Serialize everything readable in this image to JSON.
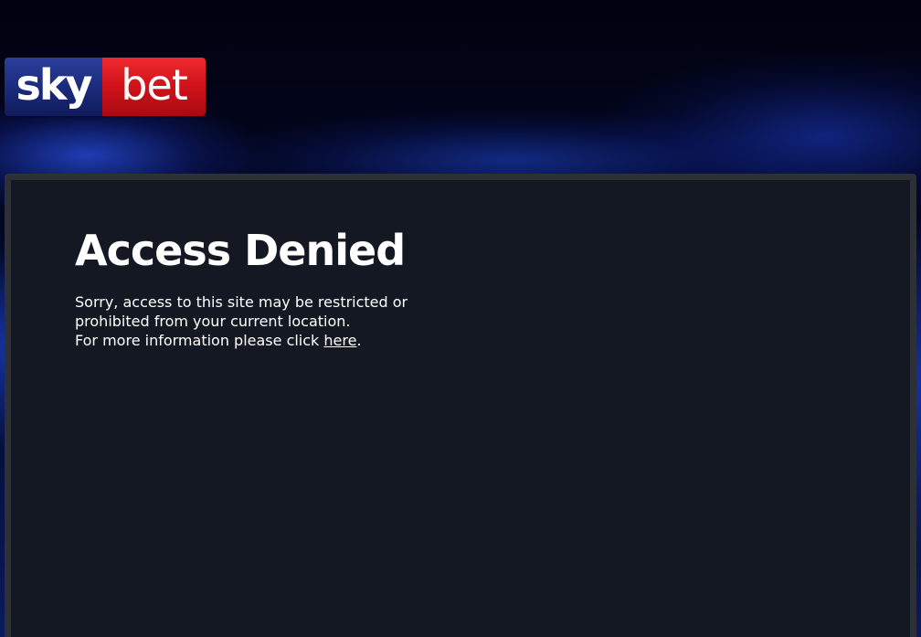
{
  "logo": {
    "part1": "sky",
    "part2": "bet"
  },
  "content": {
    "title": "Access Denied",
    "line1": "Sorry, access to this site may be restricted or",
    "line2": "prohibited from your current location.",
    "line3_prefix": "For more information please click ",
    "link_text": "here",
    "line3_suffix": "."
  },
  "colors": {
    "sky_blue": "#1a2a7a",
    "bet_red": "#d0121a",
    "panel_bg": "#131823",
    "panel_border": "#2d3036",
    "text": "#ffffff"
  }
}
